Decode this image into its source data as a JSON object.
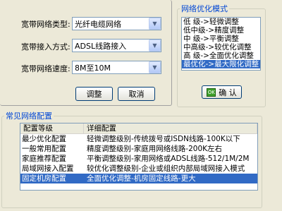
{
  "form": {
    "type_label": "宽带网络类型:",
    "type_value": "光纤电缆网络",
    "access_label": "宽带接入方式:",
    "access_value": "ADSL线路接入",
    "speed_label": "宽带网络速度:",
    "speed_value": "8M至10M",
    "adjust_button": "调整",
    "cancel_button": "取消"
  },
  "optimize": {
    "title": "网络优化模式",
    "items": [
      "低  级->轻微调整",
      "低中级->精度调整",
      "中  级->平衡调整",
      "中高级->较优化调整",
      "高  级->全面优化调整",
      "最优化->最大限化调整"
    ],
    "selected_index": 5,
    "confirm_button": "确 认",
    "confirm_icon": "ok-icon"
  },
  "common": {
    "title": "常见网络配置",
    "headers": [
      "配置等级",
      "详细配置"
    ],
    "rows": [
      {
        "level": "最少优化配置",
        "detail": "轻微调整级别-传统拨号或ISDN线路-100K以下"
      },
      {
        "level": "一般常用配置",
        "detail": "精度调整级别-家庭用网络线路-200K左右"
      },
      {
        "level": "家庭推荐配置",
        "detail": "平衡调整级别-家用网络或ADSL线路-512/1M/2M"
      },
      {
        "level": "局域网接入配置",
        "detail": "较优化调整级别-企业或组织内部局域网接入模式"
      },
      {
        "level": "固定机房配置",
        "detail": "全面优化调整-机房固定线路-更大"
      }
    ],
    "selected_index": 4
  }
}
